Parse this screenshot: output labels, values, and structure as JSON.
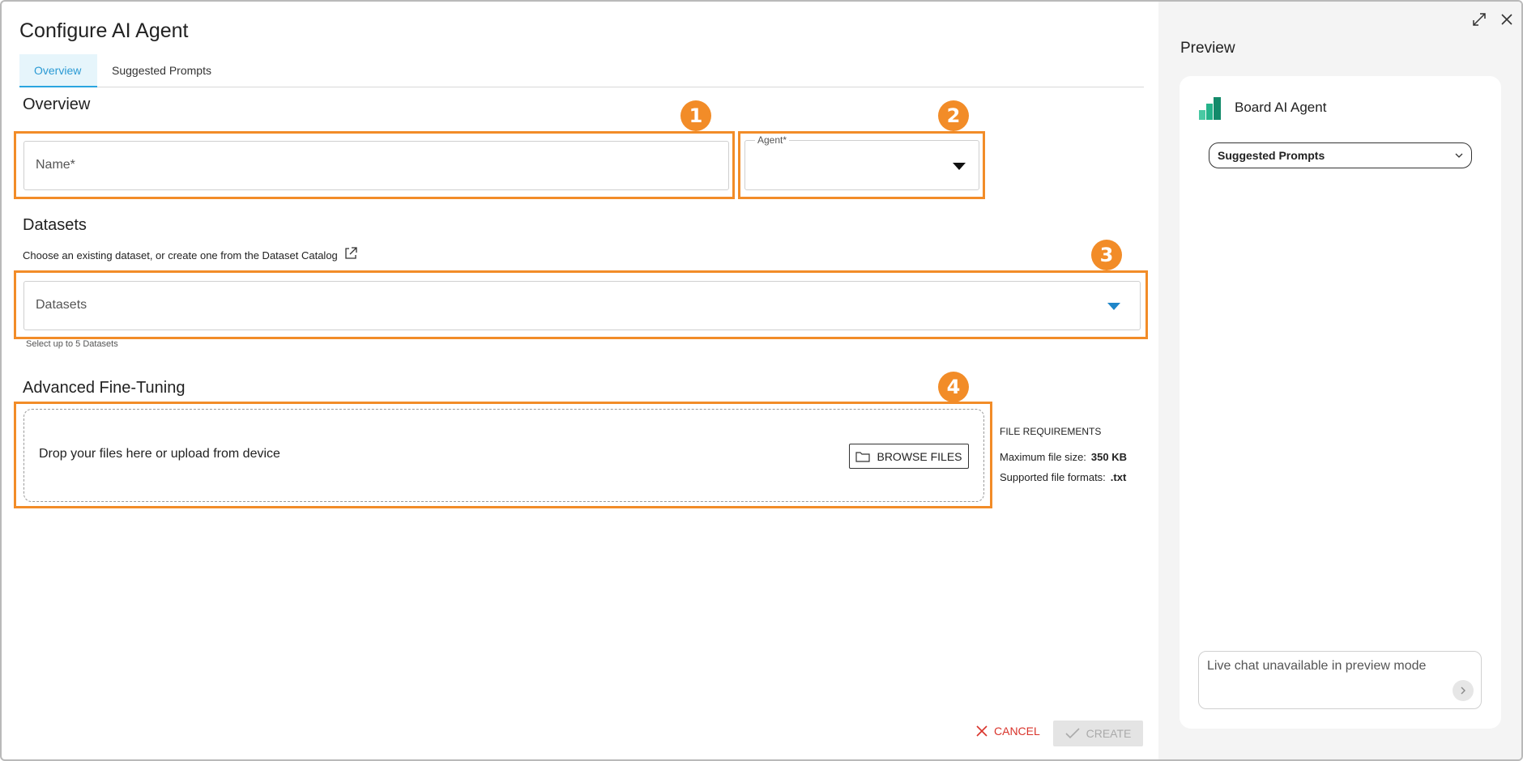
{
  "dialog": {
    "title": "Configure AI Agent"
  },
  "tabs": [
    {
      "label": "Overview",
      "active": true
    },
    {
      "label": "Suggested Prompts",
      "active": false
    }
  ],
  "overview": {
    "heading": "Overview",
    "name_placeholder": "Name*",
    "agent_label": "Agent*",
    "agent_value": ""
  },
  "datasets": {
    "heading": "Datasets",
    "hint": "Choose an existing dataset, or create one from the Dataset Catalog",
    "placeholder": "Datasets",
    "helper": "Select up to 5 Datasets"
  },
  "advanced": {
    "heading": "Advanced Fine-Tuning",
    "drop_text": "Drop your files here or upload from device",
    "browse_label": "BROWSE FILES",
    "requirements_title": "FILE REQUIREMENTS",
    "max_size_label": "Maximum file size:",
    "max_size_value": "350 KB",
    "formats_label": "Supported file formats:",
    "formats_value": ".txt"
  },
  "callouts": [
    "1",
    "2",
    "3",
    "4"
  ],
  "footer": {
    "cancel_label": "CANCEL",
    "create_label": "CREATE"
  },
  "preview": {
    "title": "Preview",
    "agent_name": "Board AI Agent",
    "select_value": "Suggested Prompts",
    "chat_placeholder": "Live chat unavailable in preview mode"
  },
  "colors": {
    "accent": "#2aa5e0",
    "callout": "#f28c28",
    "cancel": "#d9342b"
  }
}
